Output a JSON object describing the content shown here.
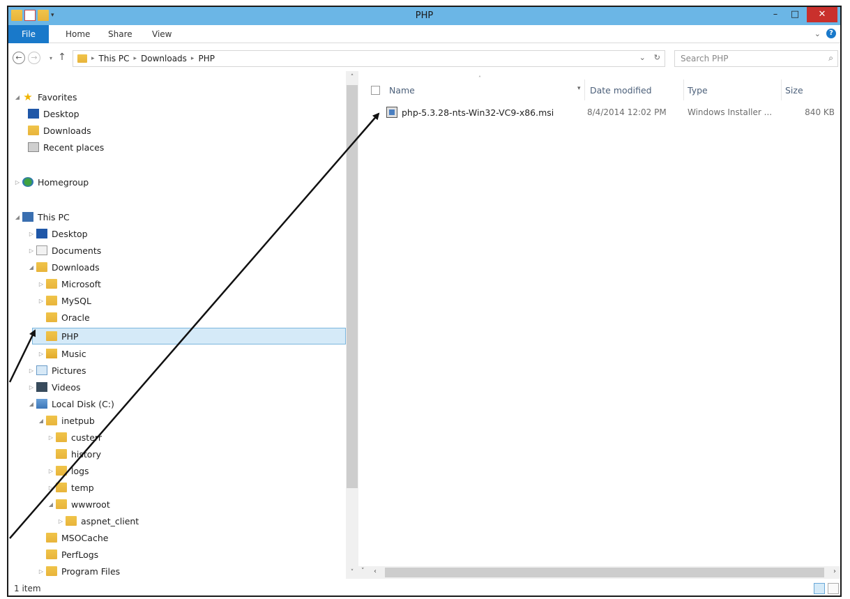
{
  "window": {
    "title": "PHP",
    "minimize_glyph": "–",
    "maximize_glyph": "□",
    "close_glyph": "✕"
  },
  "ribbon": {
    "tabs": [
      "File",
      "Home",
      "Share",
      "View"
    ],
    "expand_glyph": "⌄",
    "help_glyph": "?"
  },
  "address": {
    "back_glyph": "←",
    "forward_glyph": "→",
    "recent_glyph": "▾",
    "up_glyph": "↑",
    "path": [
      "This PC",
      "Downloads",
      "PHP"
    ],
    "separator": "▸",
    "dropdown_glyph": "⌄",
    "refresh_glyph": "↻"
  },
  "search": {
    "placeholder": "Search PHP",
    "icon_glyph": "⌕"
  },
  "nav": {
    "favorites": "Favorites",
    "desktop": "Desktop",
    "downloads": "Downloads",
    "recent_places": "Recent places",
    "homegroup": "Homegroup",
    "this_pc": "This PC",
    "pc_desktop": "Desktop",
    "documents": "Documents",
    "pc_downloads": "Downloads",
    "microsoft": "Microsoft",
    "mysql": "MySQL",
    "oracle": "Oracle",
    "php": "PHP",
    "music": "Music",
    "pictures": "Pictures",
    "videos": "Videos",
    "local_disk": "Local Disk (C:)",
    "inetpub": "inetpub",
    "custerr": "custerr",
    "history": "history",
    "logs": "logs",
    "temp": "temp",
    "wwwroot": "wwwroot",
    "aspnet_client": "aspnet_client",
    "msocache": "MSOCache",
    "perflogs": "PerfLogs",
    "program_files": "Program Files",
    "expanded_glyph": "◢",
    "collapsed_glyph": "▷"
  },
  "columns": {
    "name": "Name",
    "date_modified": "Date modified",
    "type": "Type",
    "size": "Size",
    "sort_glyph": "˄",
    "filter_glyph": "▾"
  },
  "files": [
    {
      "name": "php-5.3.28-nts-Win32-VC9-x86.msi",
      "date_modified": "8/4/2014 12:02 PM",
      "type": "Windows Installer ...",
      "size": "840 KB"
    }
  ],
  "status": {
    "item_count": "1 item"
  },
  "scroll": {
    "up_glyph": "˄",
    "down_glyph": "˅",
    "left_glyph": "‹",
    "right_glyph": "›"
  }
}
